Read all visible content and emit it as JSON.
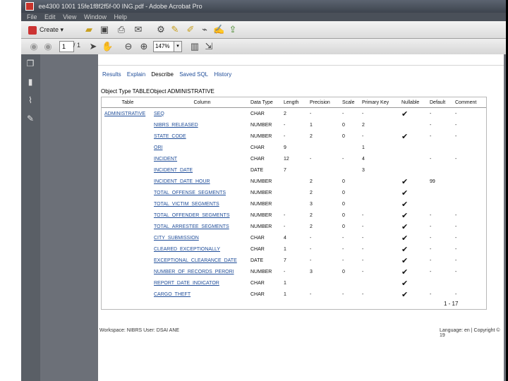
{
  "window": {
    "title": "ee4300 1001 15fe1f8f2f5f-00 ING.pdf - Adobe Acrobat Pro"
  },
  "menu": [
    "File",
    "Edit",
    "View",
    "Window",
    "Help"
  ],
  "toolbar": {
    "create_label": "Create",
    "page_current": "1",
    "page_total": "/ 1",
    "zoom": "147%"
  },
  "doc": {
    "tabs": [
      "Results",
      "Explain",
      "Describe",
      "Saved SQL",
      "History"
    ],
    "active_tab": "Describe",
    "object_type_label": "Object Type TABLE",
    "object_label": "Object ADMINISTRATIVE",
    "columns": [
      "Table",
      "Column",
      "Data Type",
      "Length",
      "Precision",
      "Scale",
      "Primary Key",
      "Nullable",
      "Default",
      "Comment"
    ],
    "rows": [
      {
        "table": "ADMINISTRATIVE",
        "column": "SEQ",
        "type": "CHAR",
        "length": "2",
        "precision": "-",
        "scale": "-",
        "pk": "-",
        "nullable": true,
        "default": "-",
        "comment": "-"
      },
      {
        "table": "",
        "column": "NIBRS_RELEASED",
        "type": "NUMBER",
        "length": "-",
        "precision": "1",
        "scale": "0",
        "pk": "2",
        "nullable": false,
        "default": "-",
        "comment": "-"
      },
      {
        "table": "",
        "column": "STATE_CODE",
        "type": "NUMBER",
        "length": "-",
        "precision": "2",
        "scale": "0",
        "pk": "-",
        "nullable": true,
        "default": "-",
        "comment": "-"
      },
      {
        "table": "",
        "column": "ORI",
        "type": "CHAR",
        "length": "9",
        "precision": "",
        "scale": "",
        "pk": "1",
        "nullable": false,
        "default": "",
        "comment": ""
      },
      {
        "table": "",
        "column": "INCIDENT",
        "type": "CHAR",
        "length": "12",
        "precision": "-",
        "scale": "-",
        "pk": "4",
        "nullable": false,
        "default": "-",
        "comment": "-"
      },
      {
        "table": "",
        "column": "INCIDENT_DATE",
        "type": "DATE",
        "length": "7",
        "precision": "",
        "scale": "",
        "pk": "3",
        "nullable": false,
        "default": "",
        "comment": ""
      },
      {
        "table": "",
        "column": "INCIDENT_DATE_HOUR",
        "type": "NUMBER",
        "length": "",
        "precision": "2",
        "scale": "0",
        "pk": "",
        "nullable": true,
        "default": "99",
        "comment": ""
      },
      {
        "table": "",
        "column": "TOTAL_OFFENSE_SEGMENTS",
        "type": "NUMBER",
        "length": "",
        "precision": "2",
        "scale": "0",
        "pk": "",
        "nullable": true,
        "default": "",
        "comment": ""
      },
      {
        "table": "",
        "column": "TOTAL_VICTIM_SEGMENTS",
        "type": "NUMBER",
        "length": "",
        "precision": "3",
        "scale": "0",
        "pk": "",
        "nullable": true,
        "default": "",
        "comment": ""
      },
      {
        "table": "",
        "column": "TOTAL_OFFENDER_SEGMENTS",
        "type": "NUMBER",
        "length": "-",
        "precision": "2",
        "scale": "0",
        "pk": "-",
        "nullable": true,
        "default": "-",
        "comment": "-"
      },
      {
        "table": "",
        "column": "TOTAL_ARRESTEE_SEGMENTS",
        "type": "NUMBER",
        "length": "-",
        "precision": "2",
        "scale": "0",
        "pk": "-",
        "nullable": true,
        "default": "-",
        "comment": "-"
      },
      {
        "table": "",
        "column": "CITY_SUBMISSION",
        "type": "CHAR",
        "length": "4",
        "precision": "-",
        "scale": "-",
        "pk": "-",
        "nullable": true,
        "default": "-",
        "comment": "-"
      },
      {
        "table": "",
        "column": "CLEARED_EXCEPTIONALLY",
        "type": "CHAR",
        "length": "1",
        "precision": "-",
        "scale": "-",
        "pk": "-",
        "nullable": true,
        "default": "-",
        "comment": "-"
      },
      {
        "table": "",
        "column": "EXCEPTIONAL_CLEARANCE_DATE",
        "type": "DATE",
        "length": "7",
        "precision": "-",
        "scale": "-",
        "pk": "-",
        "nullable": true,
        "default": "-",
        "comment": "-"
      },
      {
        "table": "",
        "column": "NUMBER_OF_RECORDS_PERORI",
        "type": "NUMBER",
        "length": "-",
        "precision": "3",
        "scale": "0",
        "pk": "-",
        "nullable": true,
        "default": "-",
        "comment": "-"
      },
      {
        "table": "",
        "column": "REPORT_DATE_INDICATOR",
        "type": "CHAR",
        "length": "1",
        "precision": "",
        "scale": "",
        "pk": "",
        "nullable": true,
        "default": "",
        "comment": ""
      },
      {
        "table": "",
        "column": "CARGO_THEFT",
        "type": "CHAR",
        "length": "1",
        "precision": "-",
        "scale": "-",
        "pk": "-",
        "nullable": true,
        "default": "-",
        "comment": "-"
      }
    ],
    "row_count": "1 - 17",
    "footer_left": "Workspace: NIBRS User: DSAI ANE",
    "footer_right": "Language: en | Copyright © 19"
  }
}
